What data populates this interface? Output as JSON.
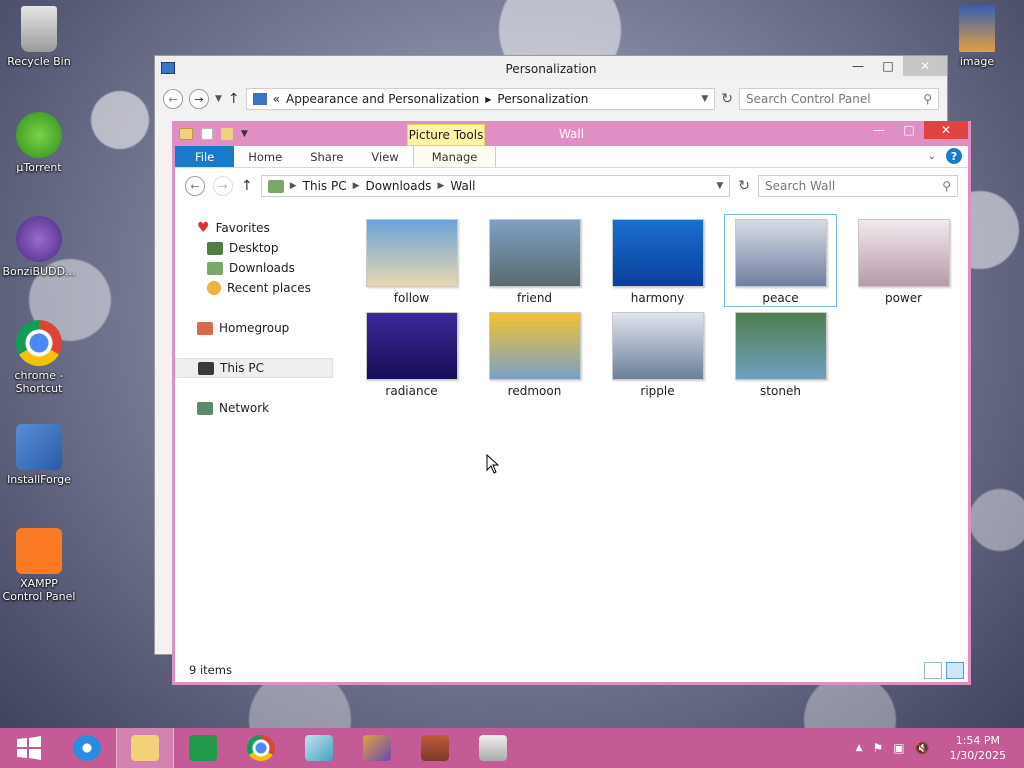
{
  "desktop": {
    "icons": [
      {
        "label": "Recycle Bin",
        "icon": "recycle-bin-icon"
      },
      {
        "label": "µTorrent",
        "icon": "utorrent-icon"
      },
      {
        "label": "BonziBUDD...",
        "icon": "bonzibuddy-icon"
      },
      {
        "label": "chrome - Shortcut",
        "icon": "chrome-icon"
      },
      {
        "label": "InstallForge",
        "icon": "installforge-icon"
      },
      {
        "label": "XAMPP Control Panel",
        "icon": "xampp-icon"
      },
      {
        "label": "image",
        "icon": "image-file-icon"
      }
    ]
  },
  "personalization_window": {
    "title": "Personalization",
    "address": {
      "prefix": "«",
      "crumbs": [
        "Appearance and Personalization",
        "Personalization"
      ]
    },
    "search_placeholder": "Search Control Panel"
  },
  "explorer": {
    "title": "Wall",
    "context_tab": "Picture Tools",
    "ribbon_tabs": [
      "File",
      "Home",
      "Share",
      "View",
      "Manage"
    ],
    "address": {
      "crumbs": [
        "This PC",
        "Downloads",
        "Wall"
      ]
    },
    "search_placeholder": "Search Wall",
    "nav": {
      "favorites": "Favorites",
      "desktop": "Desktop",
      "downloads": "Downloads",
      "recent": "Recent places",
      "homegroup": "Homegroup",
      "thispc": "This PC",
      "network": "Network"
    },
    "files": [
      {
        "name": "follow",
        "colors": [
          "#6aa3d8",
          "#e8d7b0"
        ],
        "selected": false
      },
      {
        "name": "friend",
        "colors": [
          "#7da1c4",
          "#5a6a70"
        ],
        "selected": false
      },
      {
        "name": "harmony",
        "colors": [
          "#1a6fd0",
          "#0a3f9a"
        ],
        "selected": false
      },
      {
        "name": "peace",
        "colors": [
          "#d8dce6",
          "#6f7fa0"
        ],
        "selected": true
      },
      {
        "name": "power",
        "colors": [
          "#f1e9ee",
          "#b89aa8"
        ],
        "selected": false
      },
      {
        "name": "radiance",
        "colors": [
          "#3b2a9a",
          "#150d55"
        ],
        "selected": false
      },
      {
        "name": "redmoon",
        "colors": [
          "#f2c230",
          "#7aa0c8"
        ],
        "selected": false
      },
      {
        "name": "ripple",
        "colors": [
          "#dfe5ee",
          "#6b7f9a"
        ],
        "selected": false
      },
      {
        "name": "stoneh",
        "colors": [
          "#4e7e4e",
          "#6fa0c0"
        ],
        "selected": false
      }
    ],
    "status": "9 items"
  },
  "taskbar": {
    "clock_time": "1:54 PM",
    "clock_date": "1/30/2025",
    "accent": "#c45a96"
  }
}
